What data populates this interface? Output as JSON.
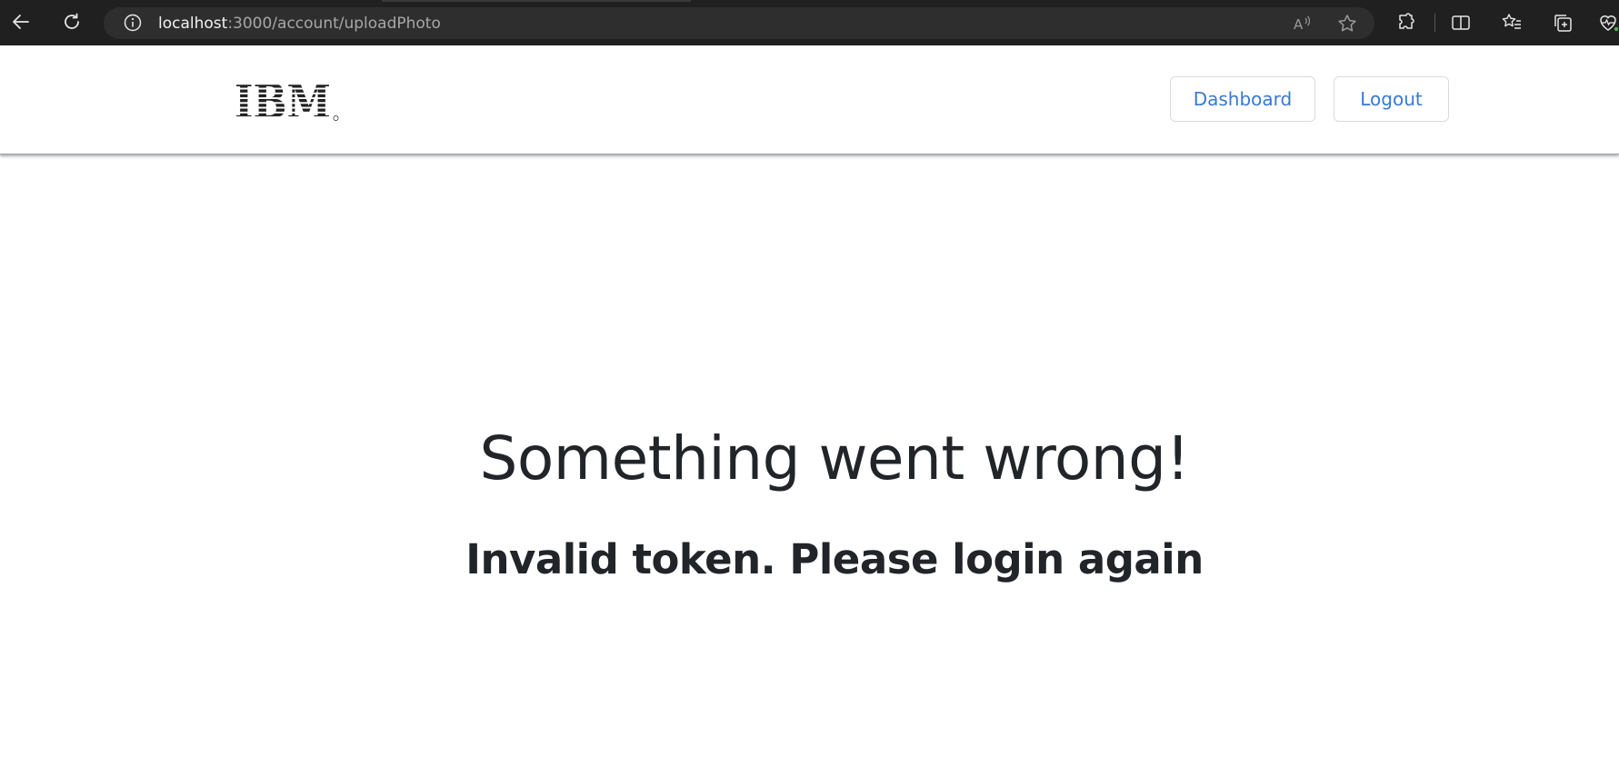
{
  "browser": {
    "url_host": "localhost",
    "url_path": ":3000/account/uploadPhoto",
    "icons": {
      "back": "back-arrow-icon",
      "refresh": "refresh-icon",
      "info": "info-icon",
      "read_aloud": "read-aloud-icon",
      "favorite": "star-icon",
      "extensions": "puzzle-icon",
      "split_screen": "split-screen-icon",
      "favorites": "favorites-list-icon",
      "collections": "collections-icon",
      "health": "browser-essentials-icon"
    }
  },
  "header": {
    "logo_text": "IBM",
    "dashboard_label": "Dashboard",
    "logout_label": "Logout"
  },
  "error": {
    "title": "Something went wrong!",
    "message": "Invalid token. Please login again"
  },
  "colors": {
    "link_blue": "#3579d6",
    "text_dark": "#212529",
    "chrome_bg": "#202020"
  }
}
